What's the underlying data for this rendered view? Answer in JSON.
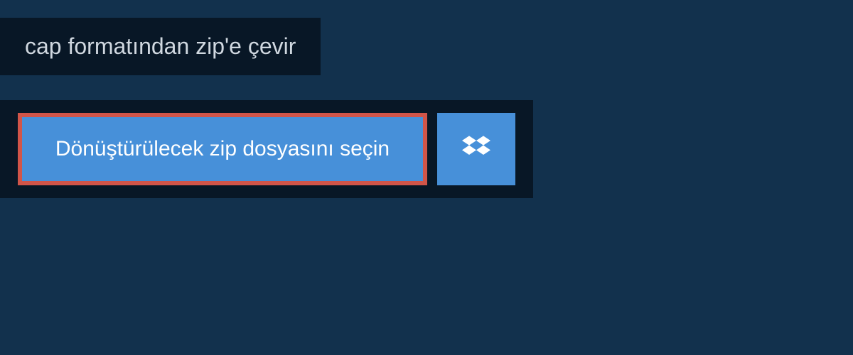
{
  "header": {
    "title": "cap formatından zip'e çevir"
  },
  "actions": {
    "selectFileLabel": "Dönüştürülecek zip dosyasını seçin"
  },
  "colors": {
    "background": "#12314d",
    "darkPanel": "#081726",
    "buttonBlue": "#4790d9",
    "highlightBorder": "#d15549"
  }
}
